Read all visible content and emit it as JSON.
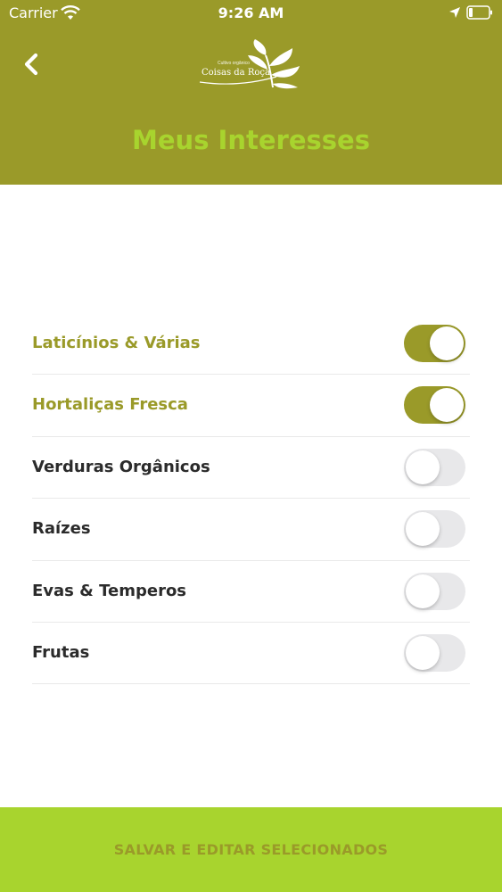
{
  "status_bar": {
    "carrier": "Carrier",
    "time": "9:26 AM"
  },
  "header": {
    "logo_text": "Coisas da Roça",
    "logo_subtext": "Cultivo orgânico",
    "title": "Meus Interesses"
  },
  "interests": [
    {
      "label": "Laticínios & Várias",
      "enabled": true
    },
    {
      "label": "Hortaliças Fresca",
      "enabled": true
    },
    {
      "label": "Verduras Orgânicos",
      "enabled": false
    },
    {
      "label": "Raízes",
      "enabled": false
    },
    {
      "label": "Evas & Temperos",
      "enabled": false
    },
    {
      "label": "Frutas",
      "enabled": false
    }
  ],
  "footer": {
    "save_label": "SALVAR E EDITAR SELECIONADOS"
  },
  "colors": {
    "header_bg": "#9a9a29",
    "accent_green": "#a8d42e",
    "toggle_on": "#9a9a29",
    "toggle_off": "#e8e8ea"
  },
  "icons": [
    "wifi-icon",
    "location-arrow-icon",
    "battery-icon",
    "chevron-left-icon",
    "leaf-logo-icon"
  ]
}
